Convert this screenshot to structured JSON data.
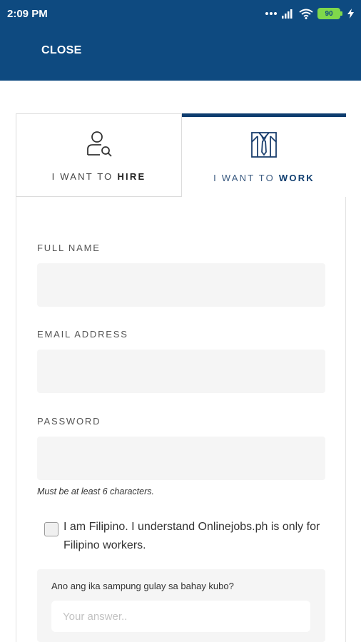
{
  "status_bar": {
    "time": "2:09 PM",
    "battery": "90",
    "icons": [
      "dots-icon",
      "signal-icon",
      "wifi-icon",
      "battery-icon",
      "charging-icon"
    ]
  },
  "app_bar": {
    "close_label": "CLOSE",
    "background": "#0e4a80"
  },
  "tabs": {
    "hire": {
      "prefix": "I WANT TO",
      "bold": "HIRE",
      "icon": "user-search-icon"
    },
    "work": {
      "prefix": "I WANT TO",
      "bold": "WORK",
      "icon": "worker-shirt-icon",
      "active": true
    },
    "active_color": "#0e3d6f"
  },
  "form": {
    "full_name": {
      "label": "FULL NAME",
      "value": ""
    },
    "email": {
      "label": "EMAIL ADDRESS",
      "value": ""
    },
    "password": {
      "label": "PASSWORD",
      "value": "",
      "hint": "Must be at least 6 characters."
    },
    "filipino_check": {
      "text": "I am Filipino. I understand Onlinejobs.ph is only for Filipino workers.",
      "checked": false
    },
    "quiz": {
      "question": "Ano ang ika sampung gulay sa bahay kubo?",
      "placeholder": "Your answer..",
      "value": ""
    }
  }
}
